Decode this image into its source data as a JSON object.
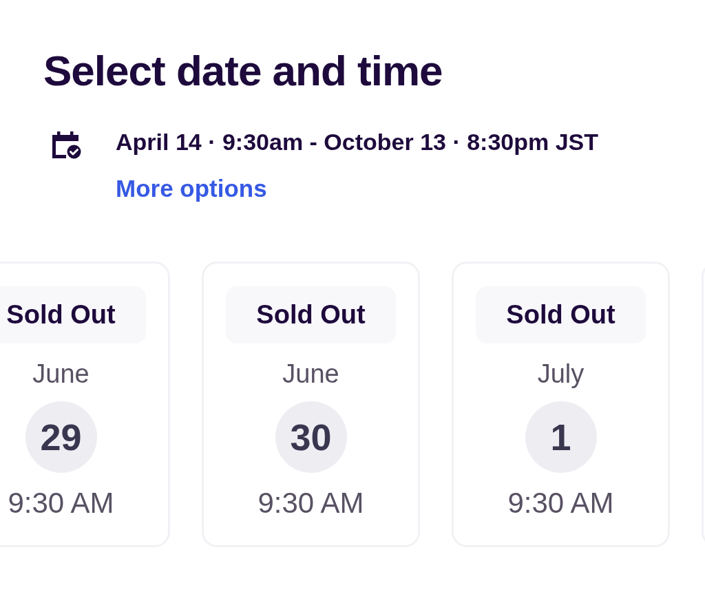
{
  "heading": "Select date and time",
  "date_range": {
    "text": "April 14 · 9:30am - October 13 · 8:30pm JST",
    "link": "More options"
  },
  "dates": [
    {
      "kind": "date",
      "status": "Sold Out",
      "month": "June",
      "day": "29",
      "time": "9:30 AM"
    },
    {
      "kind": "date",
      "status": "Sold Out",
      "month": "June",
      "day": "30",
      "time": "9:30 AM"
    },
    {
      "kind": "date",
      "status": "Sold Out",
      "month": "July",
      "day": "1",
      "time": "9:30 AM"
    },
    {
      "kind": "clipped"
    }
  ]
}
